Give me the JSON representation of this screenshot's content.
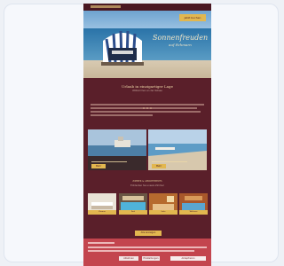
{
  "topbar": {
    "booking_label": "Jetzt buchen"
  },
  "hero": {
    "script_title": "Sonnenfreuden",
    "script_sub": "auf Fehmarn"
  },
  "welcome": {
    "title": "Urlaub in einzigartiger Lage",
    "subtitle": "Willkommen an der Ostsee"
  },
  "features": [
    {
      "button": "Mehr"
    },
    {
      "button": "Mehr"
    }
  ],
  "rooms": {
    "title": "ZIMMER & APPARTEMENTS",
    "subtitle": "Entdecken Sie unsere Zimmer",
    "items": [
      {
        "label": "Zimmer"
      },
      {
        "label": "Pool"
      },
      {
        "label": "Suite"
      },
      {
        "label": "Wellness"
      }
    ],
    "more_button": "Alle anzeigen"
  },
  "cookie": {
    "buttons": [
      "Ablehnen",
      "Einstellungen",
      "Akzeptieren"
    ]
  },
  "colors": {
    "background": "#5a1f2a",
    "accent": "#e2b74f",
    "cookie": "#c3454e"
  }
}
